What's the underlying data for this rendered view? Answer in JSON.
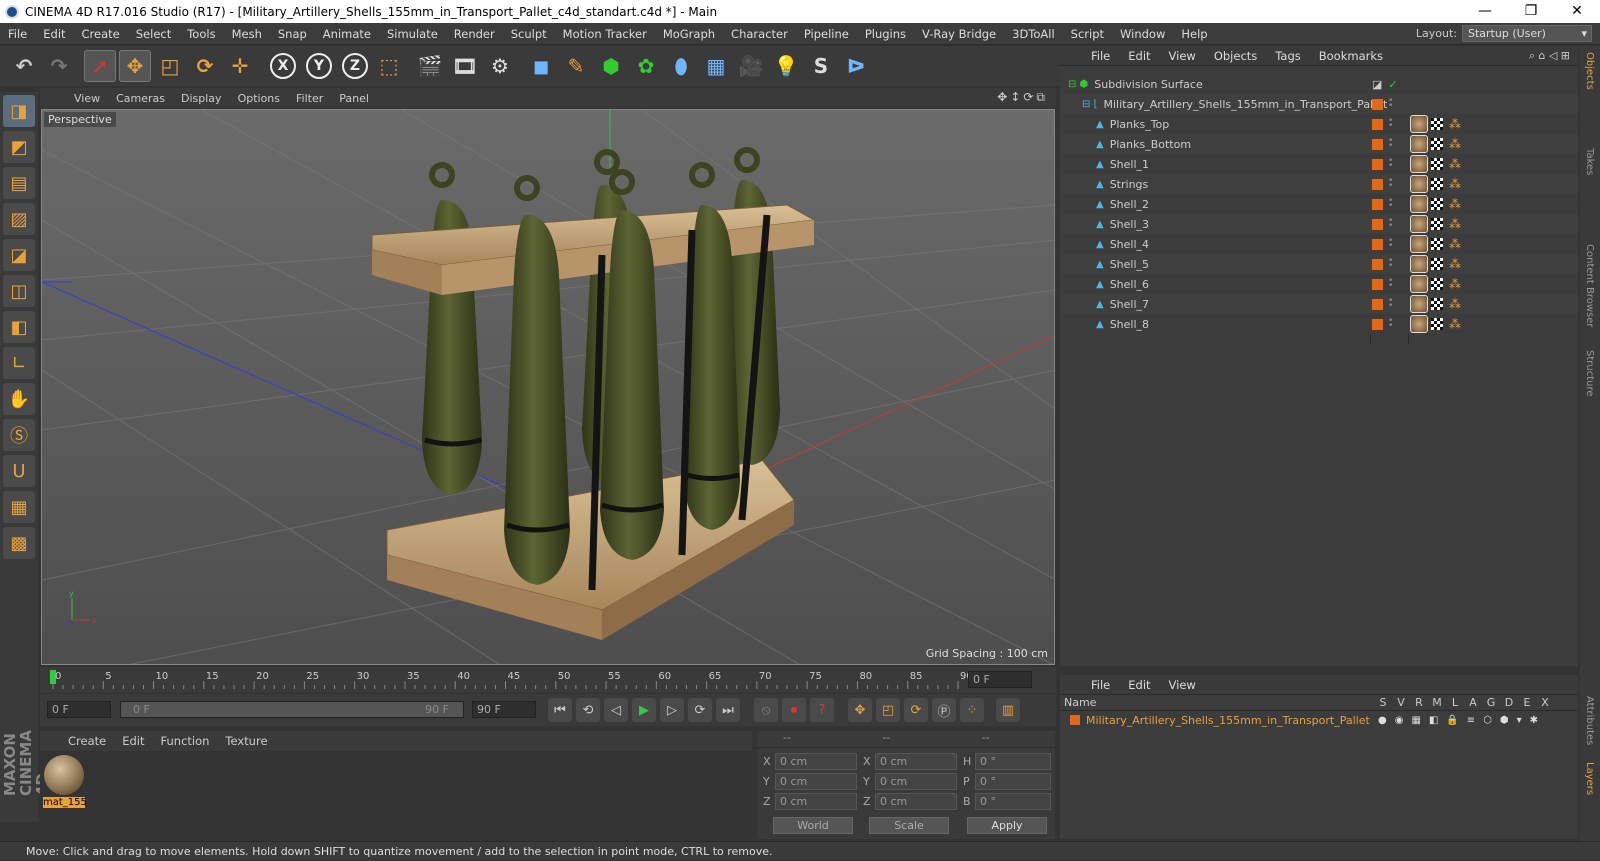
{
  "title": "CINEMA 4D R17.016 Studio (R17) - [Military_Artillery_Shells_155mm_in_Transport_Pallet_c4d_standart.c4d *] - Main",
  "window_controls": [
    "—",
    "❐",
    "✕"
  ],
  "menu": [
    "File",
    "Edit",
    "Create",
    "Select",
    "Tools",
    "Mesh",
    "Snap",
    "Animate",
    "Simulate",
    "Render",
    "Sculpt",
    "Motion Tracker",
    "MoGraph",
    "Character",
    "Pipeline",
    "Plugins",
    "V-Ray Bridge",
    "3DToAll",
    "Script",
    "Window",
    "Help"
  ],
  "layout": {
    "label": "Layout:",
    "value": "Startup (User)"
  },
  "toolbar_icons": [
    "undo-icon",
    "redo-icon",
    "select-icon",
    "move-icon",
    "scale-icon",
    "rotate-icon",
    "transform-icon",
    "x-axis-icon",
    "y-axis-icon",
    "z-axis-icon",
    "coord-system-icon",
    "render-view-icon",
    "render-picture-icon",
    "render-settings-icon",
    "cube-icon",
    "pen-icon",
    "subdivision-icon",
    "mograph-icon",
    "deformer-icon",
    "floor-icon",
    "camera-icon",
    "light-icon",
    "sketch-icon",
    "python-icon"
  ],
  "viewport": {
    "menu": [
      "View",
      "Cameras",
      "Display",
      "Options",
      "Filter",
      "Panel"
    ],
    "camera_label": "Perspective",
    "grid_spacing": "Grid Spacing : 100 cm"
  },
  "timeline": {
    "ticks": [
      "0",
      "5",
      "10",
      "15",
      "20",
      "25",
      "30",
      "35",
      "40",
      "45",
      "50",
      "55",
      "60",
      "65",
      "70",
      "75",
      "80",
      "85",
      "90"
    ],
    "current_frame": "0 F",
    "start_field": "0 F",
    "range_start": "0 F",
    "range_end": "90 F",
    "end_field": "90 F"
  },
  "material_manager": {
    "menu": [
      "Create",
      "Edit",
      "Function",
      "Texture"
    ],
    "materials": [
      {
        "name": "mat_155"
      }
    ]
  },
  "coordinates": {
    "header": [
      "--",
      "--",
      "--"
    ],
    "rows": [
      {
        "a_label": "X",
        "a_val": "0 cm",
        "b_label": "X",
        "b_val": "0 cm",
        "c_label": "H",
        "c_val": "0 °"
      },
      {
        "a_label": "Y",
        "a_val": "0 cm",
        "b_label": "Y",
        "b_val": "0 cm",
        "c_label": "P",
        "c_val": "0 °"
      },
      {
        "a_label": "Z",
        "a_val": "0 cm",
        "b_label": "Z",
        "b_val": "0 cm",
        "c_label": "B",
        "c_val": "0 °"
      }
    ],
    "world": "World",
    "scale": "Scale",
    "apply": "Apply"
  },
  "object_manager": {
    "menu": [
      "File",
      "Edit",
      "View",
      "Objects",
      "Tags",
      "Bookmarks"
    ],
    "objects": [
      {
        "name": "Subdivision Surface",
        "level": 0
      },
      {
        "name": "Military_Artillery_Shells_155mm_in_Transport_Pallet",
        "level": 1
      },
      {
        "name": "Planks_Top",
        "level": 2
      },
      {
        "name": "Planks_Bottom",
        "level": 2
      },
      {
        "name": "Shell_1",
        "level": 2
      },
      {
        "name": "Strings",
        "level": 2
      },
      {
        "name": "Shell_2",
        "level": 2
      },
      {
        "name": "Shell_3",
        "level": 2
      },
      {
        "name": "Shell_4",
        "level": 2
      },
      {
        "name": "Shell_5",
        "level": 2
      },
      {
        "name": "Shell_6",
        "level": 2
      },
      {
        "name": "Shell_7",
        "level": 2
      },
      {
        "name": "Shell_8",
        "level": 2
      }
    ]
  },
  "right_tabs": [
    "Objects",
    "Takes",
    "Content Browser",
    "Structure"
  ],
  "right_tabs_bottom": [
    "Attributes",
    "Layers"
  ],
  "layer_manager": {
    "menu": [
      "File",
      "Edit",
      "View"
    ],
    "name_header": "Name",
    "columns": [
      "S",
      "V",
      "R",
      "M",
      "L",
      "A",
      "G",
      "D",
      "E",
      "X"
    ],
    "layers": [
      {
        "name": "Military_Artillery_Shells_155mm_in_Transport_Pallet",
        "color": "#e06a1a"
      }
    ]
  },
  "status": "Move: Click and drag to move elements. Hold down SHIFT to quantize movement / add to the selection in point mode, CTRL to remove.",
  "colors": {
    "accent": "#e8a23a",
    "shell": "#4a5228",
    "wood": "#c9a77a",
    "strap": "#1a1a1a"
  }
}
